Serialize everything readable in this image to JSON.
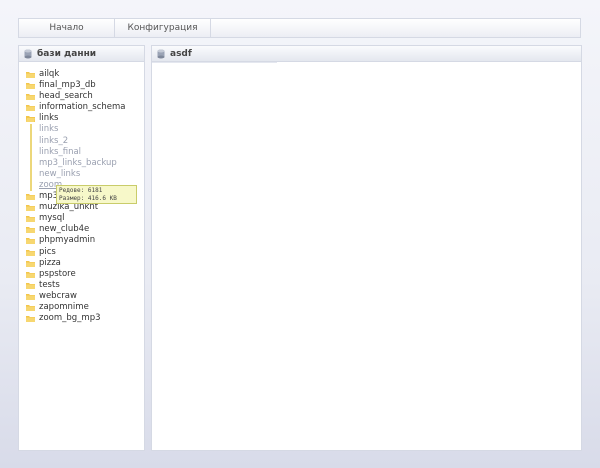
{
  "nav": {
    "home_label": "Начало",
    "config_label": "Конфигурация"
  },
  "left_panel": {
    "title": "бази данни",
    "icon": "database-icon",
    "databases": [
      "ailqk",
      "final_mp3_db",
      "head_search",
      "information_schema",
      "links",
      "mp3",
      "muzika_unknt",
      "mysql",
      "new_club4e",
      "phpmyadmin",
      "pics",
      "pizza",
      "pspstore",
      "tests",
      "webcraw",
      "zapomnime",
      "zoom_bg_mp3"
    ],
    "expanded": "links",
    "tables": [
      "links",
      "links_2",
      "links_final",
      "mp3_links_backup",
      "new_links",
      "zoom"
    ]
  },
  "tooltip": {
    "rows_label": "Редове:",
    "rows_value": "6181",
    "size_label": "Размер:",
    "size_value": "416.6 KB"
  },
  "right_panel": {
    "title": "asdf",
    "icon": "database-icon"
  },
  "colors": {
    "folder": "#f3c64a",
    "tree_line": "#ecd77a",
    "tooltip_bg": "#f7f8c9"
  }
}
